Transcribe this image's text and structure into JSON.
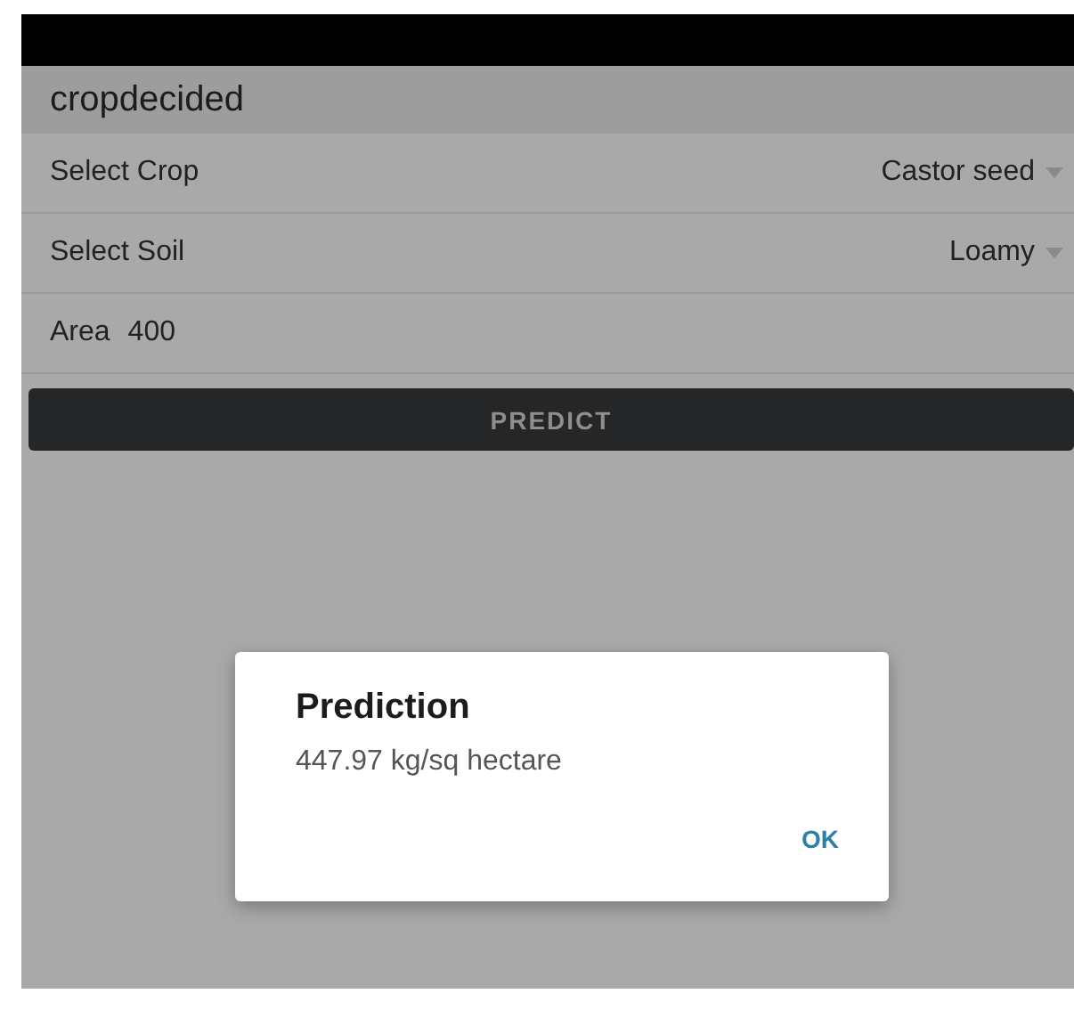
{
  "app_bar": {
    "title": "cropdecided"
  },
  "form": {
    "crop": {
      "label": "Select Crop",
      "value": "Castor seed"
    },
    "soil": {
      "label": "Select Soil",
      "value": "Loamy"
    },
    "area": {
      "label": "Area",
      "value": "400"
    },
    "button": "PREDICT"
  },
  "dialog": {
    "title": "Prediction",
    "message": "447.97 kg/sq hectare",
    "button": "OK"
  }
}
